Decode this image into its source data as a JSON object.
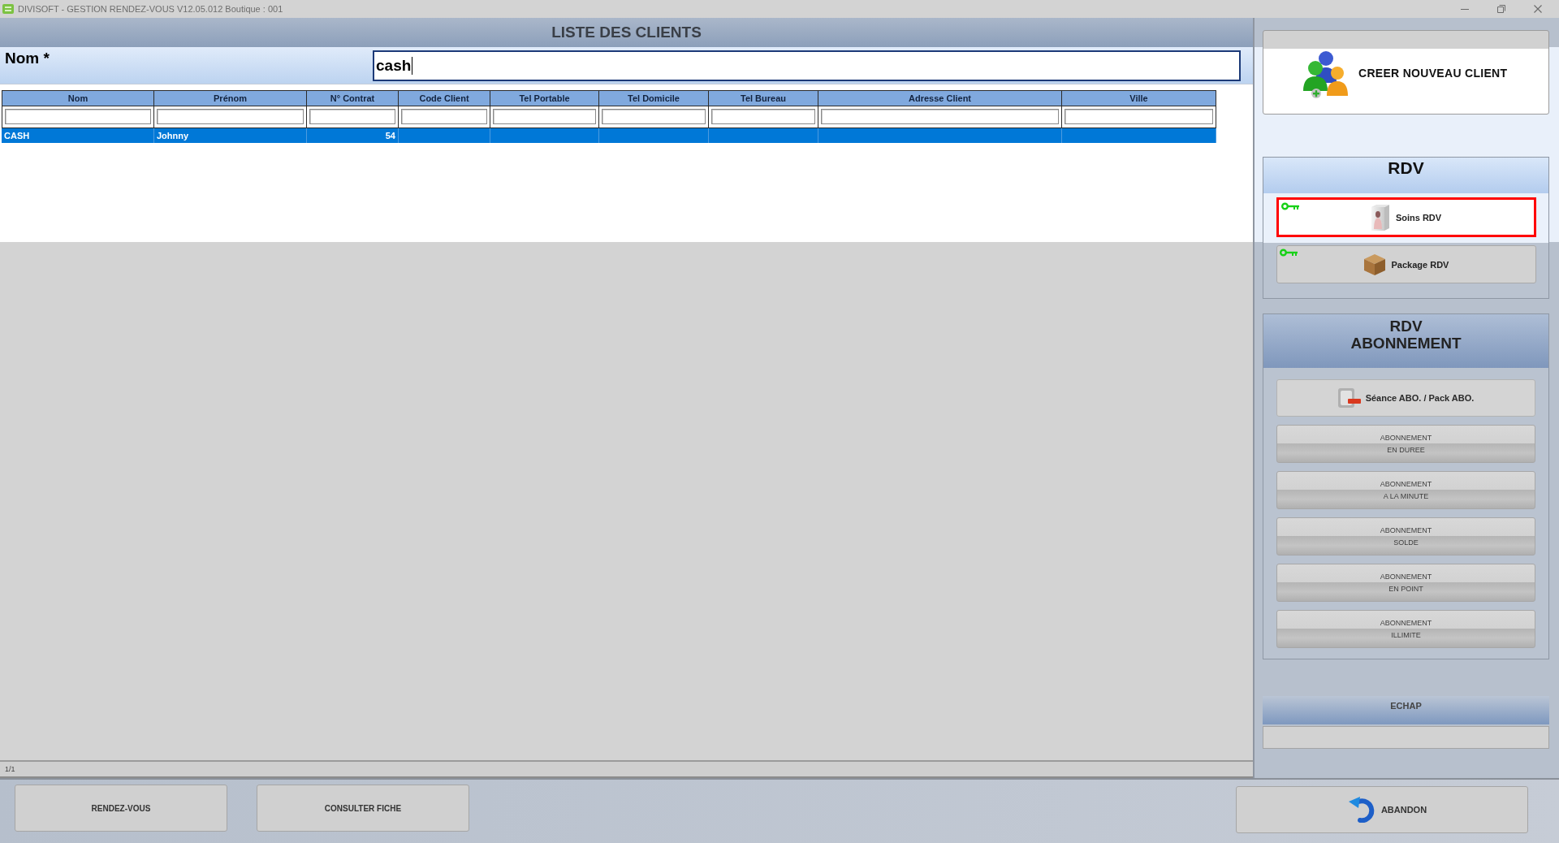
{
  "window": {
    "title": "DIVISOFT - GESTION RENDEZ-VOUS V12.05.012 Boutique : 001"
  },
  "header": {
    "title": "LISTE DES CLIENTS"
  },
  "search": {
    "label": "Nom *",
    "value": "cash"
  },
  "table": {
    "columns": [
      {
        "label": "Nom"
      },
      {
        "label": "Prénom"
      },
      {
        "label": "N° Contrat"
      },
      {
        "label": "Code Client"
      },
      {
        "label": "Tel Portable"
      },
      {
        "label": "Tel Domicile"
      },
      {
        "label": "Tel Bureau"
      },
      {
        "label": "Adresse Client"
      },
      {
        "label": "Ville"
      }
    ],
    "rows": [
      {
        "cells": [
          "CASH",
          "Johnny",
          "54"
        ],
        "selected": true
      }
    ]
  },
  "status_bar": {
    "text": "1/1"
  },
  "sidebar": {
    "create_button": {
      "label": "CREER NOUVEAU CLIENT"
    },
    "rdv": {
      "title": "RDV",
      "buttons": [
        {
          "kind": "care",
          "label": "Soins RDV",
          "focused": true,
          "keyed": true
        },
        {
          "kind": "package",
          "label": "Package RDV",
          "focused": false,
          "keyed": true
        }
      ]
    },
    "subscription": {
      "title": "RDV ABONNEMENT",
      "buttons": [
        {
          "kind": "pass",
          "lines": [
            "Séance ABO. / Pack ABO."
          ],
          "disabled": false
        },
        {
          "kind": "split",
          "lines": [
            "ABONNEMENT",
            "EN DUREE"
          ],
          "disabled": true
        },
        {
          "kind": "split",
          "lines": [
            "ABONNEMENT",
            "A LA MINUTE"
          ],
          "disabled": true
        },
        {
          "kind": "split",
          "lines": [
            "ABONNEMENT",
            "SOLDE"
          ],
          "disabled": true
        },
        {
          "kind": "split",
          "lines": [
            "ABONNEMENT",
            "EN POINT"
          ],
          "disabled": true
        },
        {
          "kind": "split",
          "lines": [
            "ABONNEMENT",
            "ILLIMITE"
          ],
          "disabled": true
        }
      ]
    },
    "escape": {
      "label": "ECHAP"
    }
  },
  "bottom_bar": {
    "buttons": [
      {
        "label": "RENDEZ-VOUS"
      },
      {
        "label": "CONSULTER FICHE"
      }
    ],
    "abandon": {
      "label": "ABANDON"
    }
  }
}
